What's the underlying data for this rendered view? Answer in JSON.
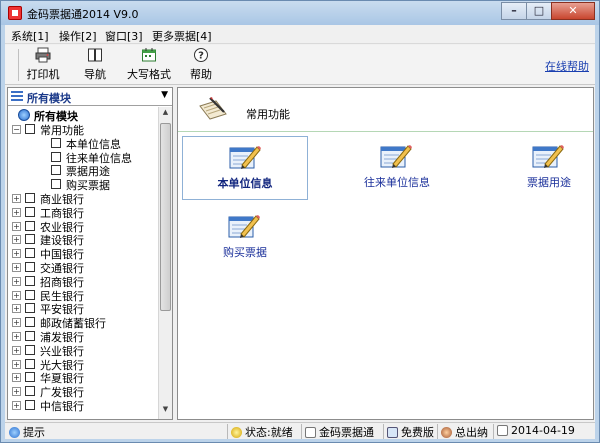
{
  "window": {
    "title": "金码票据通2014 V9.0"
  },
  "menu": [
    "系统[1]",
    "操作[2]",
    "窗口[3]",
    "更多票据[4]"
  ],
  "toolbar": {
    "buttons": [
      {
        "label": "打印机",
        "icon": "printer-icon"
      },
      {
        "label": "导航",
        "icon": "book-icon"
      },
      {
        "label": "大写格式",
        "icon": "calendar-icon"
      },
      {
        "label": "帮助",
        "icon": "help-icon"
      }
    ],
    "online_help": "在线帮助"
  },
  "module_select": {
    "value": "所有模块"
  },
  "tree": {
    "root": "所有模块",
    "items": [
      {
        "label": "常用功能",
        "level": 1,
        "expander": "−"
      },
      {
        "label": "本单位信息",
        "level": 2
      },
      {
        "label": "往来单位信息",
        "level": 2
      },
      {
        "label": "票据用途",
        "level": 2
      },
      {
        "label": "购买票据",
        "level": 2
      },
      {
        "label": "商业银行",
        "level": 1,
        "expander": "+"
      },
      {
        "label": "工商银行",
        "level": 1,
        "expander": "+"
      },
      {
        "label": "农业银行",
        "level": 1,
        "expander": "+"
      },
      {
        "label": "建设银行",
        "level": 1,
        "expander": "+"
      },
      {
        "label": "中国银行",
        "level": 1,
        "expander": "+"
      },
      {
        "label": "交通银行",
        "level": 1,
        "expander": "+"
      },
      {
        "label": "招商银行",
        "level": 1,
        "expander": "+"
      },
      {
        "label": "民生银行",
        "level": 1,
        "expander": "+"
      },
      {
        "label": "平安银行",
        "level": 1,
        "expander": "+"
      },
      {
        "label": "邮政储蓄银行",
        "level": 1,
        "expander": "+"
      },
      {
        "label": "浦发银行",
        "level": 1,
        "expander": "+"
      },
      {
        "label": "兴业银行",
        "level": 1,
        "expander": "+"
      },
      {
        "label": "光大银行",
        "level": 1,
        "expander": "+"
      },
      {
        "label": "华夏银行",
        "level": 1,
        "expander": "+"
      },
      {
        "label": "广发银行",
        "level": 1,
        "expander": "+"
      },
      {
        "label": "中信银行",
        "level": 1,
        "expander": "+"
      }
    ]
  },
  "content": {
    "header": "常用功能",
    "tiles": [
      {
        "label": "本单位信息",
        "selected": true
      },
      {
        "label": "往来单位信息",
        "selected": false
      },
      {
        "label": "票据用途",
        "selected": false
      },
      {
        "label": "购买票据",
        "selected": false
      }
    ]
  },
  "status": {
    "hint": "提示",
    "state": "状态:就绪",
    "app": "金码票据通",
    "edition": "免费版",
    "issuer": "总出纳",
    "date": "2014-04-19"
  },
  "colors": {
    "accent": "#1a2f9a",
    "titlebar": "#a9c6e5",
    "close": "#c8452e"
  }
}
